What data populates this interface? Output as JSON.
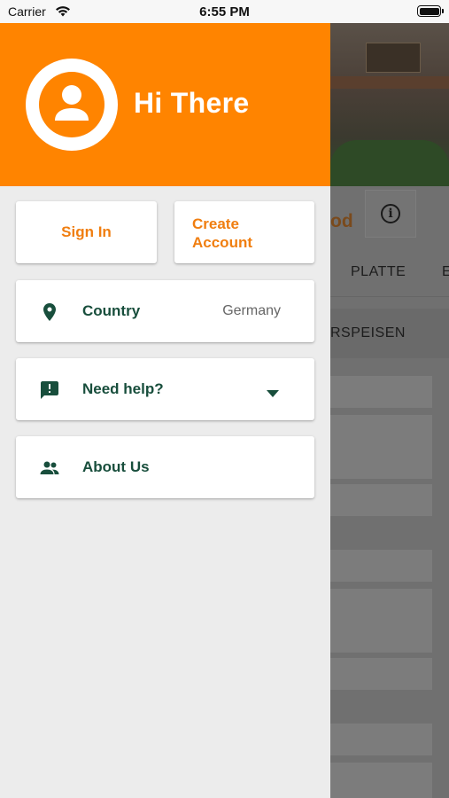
{
  "status_bar": {
    "carrier": "Carrier",
    "time": "6:55 PM"
  },
  "colors": {
    "accent": "#ff8400",
    "accent_text": "#f07e10",
    "label_text": "#184e3c",
    "drawer_bg": "#ececec"
  },
  "drawer": {
    "greeting": "Hi There",
    "avatar_icon": "user-avatar-icon",
    "buttons": {
      "sign_in": "Sign In",
      "create_account": "Create Account"
    },
    "items": [
      {
        "label": "Country",
        "value": "Germany",
        "icon": "location-pin-icon"
      },
      {
        "label": "Need help?",
        "icon": "feedback-icon",
        "trailing_icon": "chevron-down-icon"
      },
      {
        "label": "About Us",
        "icon": "people-icon"
      }
    ]
  },
  "background": {
    "restaurant_name_fragment": "od",
    "tabs": [
      "PLATTE",
      "E"
    ],
    "section_label": "RSPEISEN"
  }
}
